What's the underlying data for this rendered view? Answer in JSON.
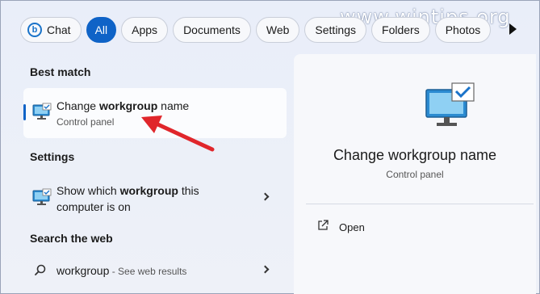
{
  "filters": {
    "chat": "Chat",
    "all": "All",
    "apps": "Apps",
    "documents": "Documents",
    "web": "Web",
    "settings": "Settings",
    "folders": "Folders",
    "photos": "Photos"
  },
  "watermark": "www.wintips.org",
  "best_match": {
    "heading": "Best match",
    "title_prefix": "Change ",
    "title_bold": "workgroup",
    "title_suffix": " name",
    "subtitle": "Control panel"
  },
  "settings_section": {
    "heading": "Settings",
    "line1_prefix": "Show which ",
    "line1_bold": "workgroup",
    "line1_suffix": " this",
    "line2": "computer is on"
  },
  "web_section": {
    "heading": "Search the web",
    "query": "workgroup",
    "hint": " - See web results"
  },
  "detail": {
    "title": "Change workgroup name",
    "subtitle": "Control panel",
    "open_label": "Open"
  },
  "colors": {
    "accent": "#0f63c7",
    "annotation_arrow": "#e0262b"
  },
  "icons": {
    "monitor": "control-panel-monitor-icon",
    "search": "search-icon",
    "open": "open-external-icon",
    "chevron": "chevron-right-icon"
  }
}
